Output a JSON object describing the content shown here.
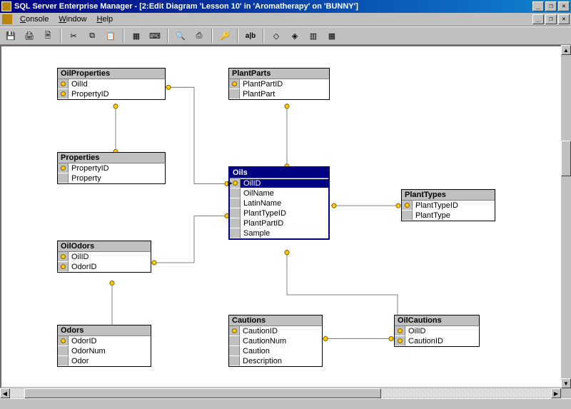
{
  "app": {
    "title": "SQL Server Enterprise Manager - [2:Edit Diagram 'Lesson 10' in 'Aromatherapy' on 'BUNNY']"
  },
  "menu": {
    "console": "Console",
    "window": "Window",
    "help": "Help"
  },
  "toolbar": {
    "save": "💾",
    "print": "🖨",
    "printprev": "🗎",
    "cut": "✂",
    "copy": "⧉",
    "paste": "📋",
    "newtable": "▦",
    "calc": "⌨",
    "zoom": "🔍",
    "pagebreak": "⎙",
    "key": "🔑",
    "textlabel": "a|b",
    "rel1": "◇",
    "rel2": "◈",
    "rel3": "▥",
    "grid": "▦"
  },
  "tables": {
    "OilProperties": {
      "title": "OilProperties",
      "cols": [
        {
          "name": "OilId",
          "pk": true
        },
        {
          "name": "PropertyID",
          "pk": true
        }
      ]
    },
    "Properties": {
      "title": "Properties",
      "cols": [
        {
          "name": "PropertyID",
          "pk": true
        },
        {
          "name": "Property",
          "pk": false
        }
      ]
    },
    "OilOdors": {
      "title": "OilOdors",
      "cols": [
        {
          "name": "OilID",
          "pk": true
        },
        {
          "name": "OdorID",
          "pk": true
        }
      ]
    },
    "Odors": {
      "title": "Odors",
      "cols": [
        {
          "name": "OdorID",
          "pk": true
        },
        {
          "name": "OdorNum",
          "pk": false
        },
        {
          "name": "Odor",
          "pk": false
        }
      ]
    },
    "PlantParts": {
      "title": "PlantParts",
      "cols": [
        {
          "name": "PlantPartID",
          "pk": true
        },
        {
          "name": "PlantPart",
          "pk": false
        }
      ]
    },
    "Oils": {
      "title": "Oils",
      "cols": [
        {
          "name": "OilID",
          "pk": true,
          "selected": true
        },
        {
          "name": "OilName",
          "pk": false
        },
        {
          "name": "LatinName",
          "pk": false
        },
        {
          "name": "PlantTypeID",
          "pk": false
        },
        {
          "name": "PlantPartID",
          "pk": false
        },
        {
          "name": "Sample",
          "pk": false
        }
      ]
    },
    "PlantTypes": {
      "title": "PlantTypes",
      "cols": [
        {
          "name": "PlantTypeID",
          "pk": true
        },
        {
          "name": "PlantType",
          "pk": false
        }
      ]
    },
    "Cautions": {
      "title": "Cautions",
      "cols": [
        {
          "name": "CautionID",
          "pk": true
        },
        {
          "name": "CautionNum",
          "pk": false
        },
        {
          "name": "Caution",
          "pk": false
        },
        {
          "name": "Description",
          "pk": false
        }
      ]
    },
    "OilCautions": {
      "title": "OilCautions",
      "cols": [
        {
          "name": "OilID",
          "pk": true
        },
        {
          "name": "CautionID",
          "pk": true
        }
      ]
    }
  }
}
